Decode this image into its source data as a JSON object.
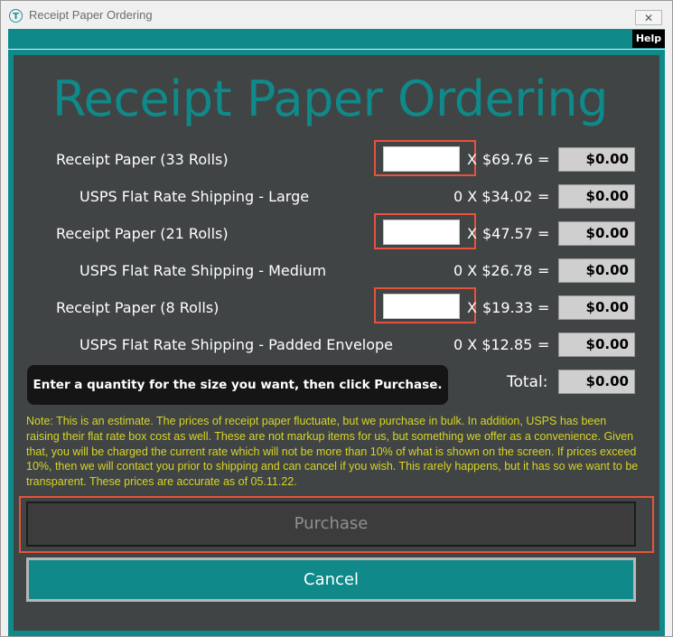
{
  "window": {
    "title": "Receipt Paper Ordering",
    "close_glyph": "✕",
    "help_label": "Help",
    "app_icon_letter": "T"
  },
  "heading": "Receipt Paper Ordering",
  "rows": [
    {
      "label": "Receipt Paper (33 Rolls)",
      "x": "X",
      "price": "$69.76",
      "eq": "=",
      "total": "$0.00",
      "qty": ""
    },
    {
      "label": "USPS Flat Rate Shipping - Large",
      "ship": "0 X $34.02",
      "eq": "=",
      "total": "$0.00"
    },
    {
      "label": "Receipt Paper (21 Rolls)",
      "x": "X",
      "price": "$47.57",
      "eq": "=",
      "total": "$0.00",
      "qty": ""
    },
    {
      "label": "USPS Flat Rate Shipping - Medium",
      "ship": "0 X $26.78",
      "eq": "=",
      "total": "$0.00"
    },
    {
      "label": "Receipt Paper (8 Rolls)",
      "x": "X",
      "price": "$19.33",
      "eq": "=",
      "total": "$0.00",
      "qty": ""
    },
    {
      "label": "USPS Flat Rate Shipping - Padded Envelope",
      "ship": "0 X $12.85",
      "eq": "=",
      "total": "$0.00"
    }
  ],
  "hint": "Enter a quantity for the size you want, then click Purchase.",
  "total_label": "Total:",
  "total_value": "$0.00",
  "note": "Note: This is an estimate. The prices of receipt paper fluctuate, but we purchase in bulk. In addition, USPS has been raising their flat rate box cost as well. These are not markup items for us, but something we offer as a convenience. Given that, you will be charged the current rate which will not be more than 10% of what is shown on the screen. If prices exceed 10%, then we will contact you prior to shipping and can cancel if you wish. This rarely happens, but it has so we want to be transparent. These prices are accurate as of 05.11.22.",
  "buttons": {
    "purchase": "Purchase",
    "cancel": "Cancel"
  },
  "colors": {
    "teal": "#0f8989",
    "panel": "#404444",
    "note": "#d7d427",
    "highlight": "#e8523a"
  }
}
